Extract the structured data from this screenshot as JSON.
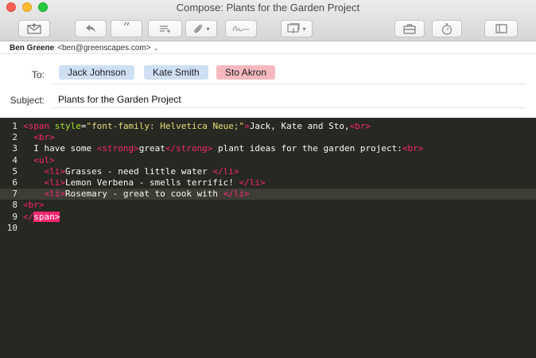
{
  "window": {
    "title": "Compose: Plants for the Garden Project"
  },
  "toolbar": {
    "buttons": [
      "send",
      "reply",
      "quote",
      "format-list",
      "attach",
      "signature",
      "stationery",
      "briefcase",
      "timer",
      "sidebar"
    ]
  },
  "from": {
    "name": "Ben Greene",
    "address": "<ben@greenscapes.com>"
  },
  "to": {
    "label": "To:",
    "recipients": [
      {
        "name": "Jack Johnson",
        "color": "#cfe0f5"
      },
      {
        "name": "Kate Smith",
        "color": "#cfe0f5"
      },
      {
        "name": "Sto Akron",
        "color": "#f7b9c0"
      }
    ]
  },
  "subject": {
    "label": "Subject:",
    "value": "Plants for the Garden Project"
  },
  "editor": {
    "active_line": 7,
    "lines": [
      {
        "num": "1",
        "parts": [
          {
            "t": "<span ",
            "c": "tag"
          },
          {
            "t": "style",
            "c": "attr"
          },
          {
            "t": "=",
            "c": "txt"
          },
          {
            "t": "\"font-family: Helvetica Neue;\"",
            "c": "str"
          },
          {
            "t": ">",
            "c": "tag"
          },
          {
            "t": "Jack, Kate and Sto,",
            "c": "txt"
          },
          {
            "t": "<br>",
            "c": "tag"
          }
        ]
      },
      {
        "num": "2",
        "parts": [
          {
            "t": "  ",
            "c": "txt"
          },
          {
            "t": "<br>",
            "c": "tag"
          }
        ]
      },
      {
        "num": "3",
        "parts": [
          {
            "t": "  I have some ",
            "c": "txt"
          },
          {
            "t": "<strong>",
            "c": "tag"
          },
          {
            "t": "great",
            "c": "txt"
          },
          {
            "t": "</strong>",
            "c": "tag"
          },
          {
            "t": " plant ideas for the garden project:",
            "c": "txt"
          },
          {
            "t": "<br>",
            "c": "tag"
          }
        ]
      },
      {
        "num": "4",
        "parts": [
          {
            "t": "  ",
            "c": "txt"
          },
          {
            "t": "<ul>",
            "c": "tag"
          }
        ]
      },
      {
        "num": "5",
        "parts": [
          {
            "t": "    ",
            "c": "txt"
          },
          {
            "t": "<li>",
            "c": "tag"
          },
          {
            "t": "Grasses - need little water ",
            "c": "txt"
          },
          {
            "t": "</li>",
            "c": "tag"
          }
        ]
      },
      {
        "num": "6",
        "parts": [
          {
            "t": "    ",
            "c": "txt"
          },
          {
            "t": "<li>",
            "c": "tag"
          },
          {
            "t": "Lemon Verbena - smells terrific! ",
            "c": "txt"
          },
          {
            "t": "</li>",
            "c": "tag"
          }
        ]
      },
      {
        "num": "7",
        "parts": [
          {
            "t": "    ",
            "c": "txt"
          },
          {
            "t": "<li>",
            "c": "tag"
          },
          {
            "t": "Rosemary - great to cook with ",
            "c": "txt"
          },
          {
            "t": "</li>",
            "c": "tag"
          }
        ]
      },
      {
        "num": "8",
        "parts": [
          {
            "t": "<br>",
            "c": "tag"
          }
        ]
      },
      {
        "num": "9",
        "parts": [
          {
            "t": "</",
            "c": "tag"
          },
          {
            "t": "span>",
            "c": "sel"
          }
        ]
      },
      {
        "num": "10",
        "parts": []
      }
    ]
  }
}
